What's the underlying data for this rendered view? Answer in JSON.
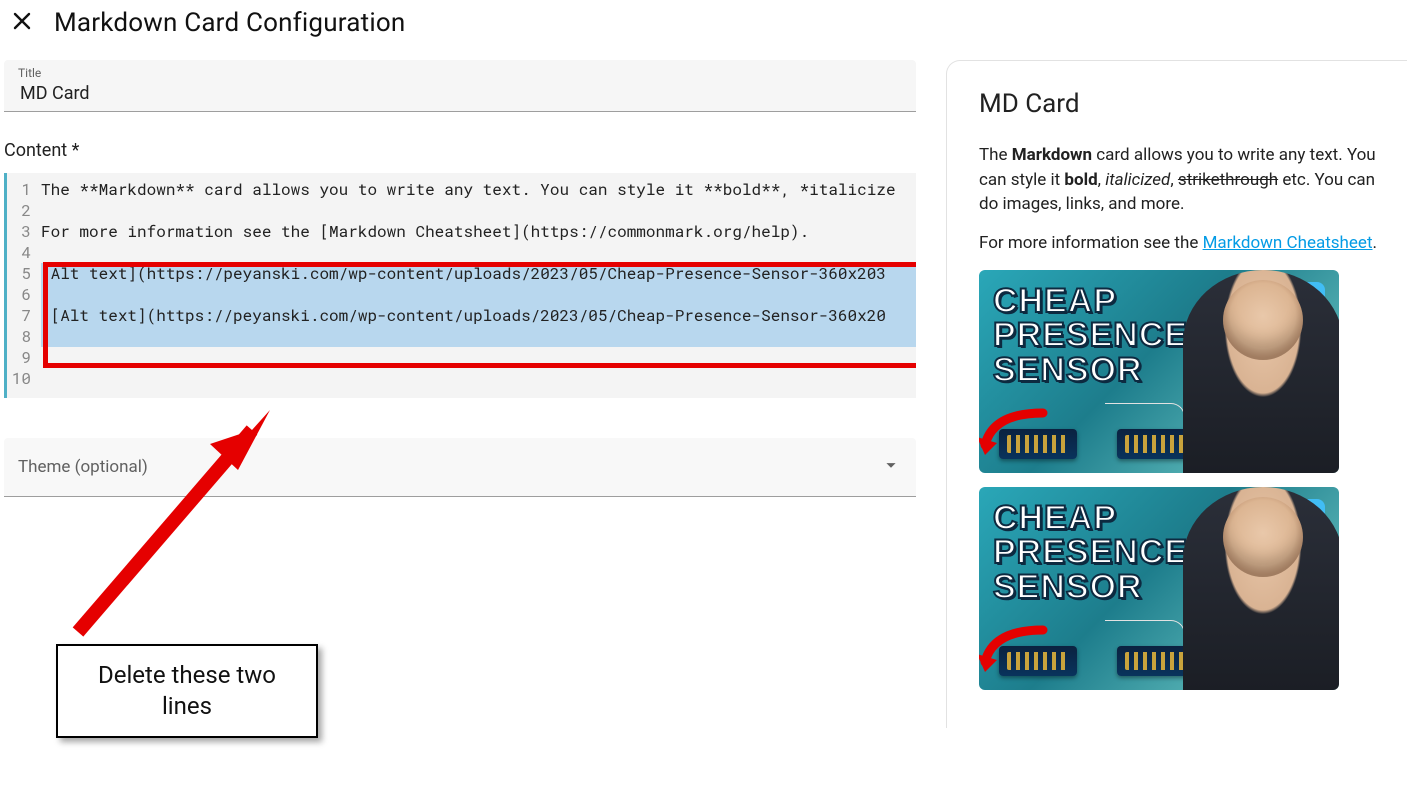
{
  "header": {
    "title": "Markdown Card Configuration"
  },
  "title_field": {
    "label": "Title",
    "value": "MD Card"
  },
  "content": {
    "label": "Content *",
    "lines": [
      "The **Markdown** card allows you to write any text. You can style it **bold**, *italicize",
      "",
      "For more information see the [Markdown Cheatsheet](https://commonmark.org/help).",
      "",
      "[Alt text](https://peyanski.com/wp-content/uploads/2023/05/Cheap-Presence-Sensor-360x203",
      "",
      "![Alt text](https://peyanski.com/wp-content/uploads/2023/05/Cheap-Presence-Sensor-360x20",
      "",
      "",
      ""
    ],
    "highlight_from": 5,
    "highlight_to": 8
  },
  "theme_select": {
    "placeholder": "Theme (optional)"
  },
  "preview": {
    "title": "MD Card",
    "p1_prefix": "The ",
    "p1_bold": "Markdown",
    "p1_mid": " card allows you to write any text. You can style it ",
    "p1_bold2": "bold",
    "p1_comma": ", ",
    "p1_italic": "italicized",
    "p1_comma2": ", ",
    "p1_strike": "strikethrough",
    "p1_tail": " etc. You can do images, links, and more.",
    "p2_prefix": "For more information see the ",
    "p2_link": "Markdown Cheatsheet",
    "p2_tail": ".",
    "thumb_text_l1": "CHEAP",
    "thumb_text_l2": "PRESENCE",
    "thumb_text_l3": "SENSOR"
  },
  "annotation": {
    "text": "Delete these two lines"
  }
}
